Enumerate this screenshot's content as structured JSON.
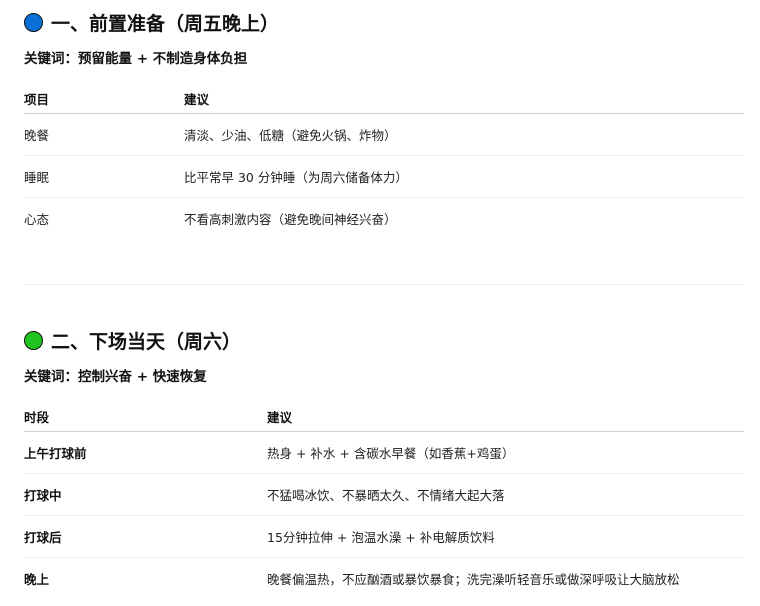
{
  "section1": {
    "title": "一、前置准备（周五晚上）",
    "dot_color": "#0a6fd8",
    "keywords": "关键词：预留能量 + 不制造身体负担",
    "headers": [
      "项目",
      "建议"
    ],
    "rows": [
      [
        "晚餐",
        "清淡、少油、低糖（避免火锅、炸物）"
      ],
      [
        "睡眠",
        "比平常早 30 分钟睡（为周六储备体力）"
      ],
      [
        "心态",
        "不看高刺激内容（避免晚间神经兴奋）"
      ]
    ]
  },
  "section2": {
    "title": "二、下场当天（周六）",
    "dot_color": "#1fc21f",
    "keywords": "关键词：控制兴奋 + 快速恢复",
    "headers": [
      "时段",
      "建议"
    ],
    "rows": [
      [
        "上午打球前",
        "热身 + 补水 + 含碳水早餐（如香蕉+鸡蛋）"
      ],
      [
        "打球中",
        "不猛喝冰饮、不暴晒太久、不情绪大起大落"
      ],
      [
        "打球后",
        "15分钟拉伸 + 泡温水澡 + 补电解质饮料"
      ],
      [
        "晚上",
        "晚餐偏温热，不应酗酒或暴饮暴食；洗完澡听轻音乐或做深呼吸让大脑放松"
      ]
    ]
  }
}
